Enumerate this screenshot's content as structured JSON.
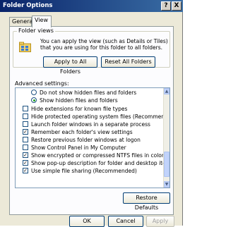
{
  "window": {
    "title": "Folder Options",
    "help_glyph": "?",
    "close_glyph": "X"
  },
  "tabs": [
    {
      "label": "General"
    },
    {
      "label": "View"
    }
  ],
  "folder_views": {
    "legend": "Folder views",
    "description": "You can apply the view (such as Details or Tiles) that you are using for this folder to all folders.",
    "apply_button": "Apply to All Folders",
    "reset_button": "Reset All Folders"
  },
  "advanced": {
    "label": "Advanced settings:",
    "items": [
      {
        "type": "radio",
        "checked": false,
        "label": "Do not show hidden files and folders"
      },
      {
        "type": "radio",
        "checked": true,
        "label": "Show hidden files and folders"
      },
      {
        "type": "check",
        "checked": false,
        "label": "Hide extensions for known file types"
      },
      {
        "type": "check",
        "checked": false,
        "label": "Hide protected operating system files (Recommended)"
      },
      {
        "type": "check",
        "checked": false,
        "label": "Launch folder windows in a separate process"
      },
      {
        "type": "check",
        "checked": true,
        "label": "Remember each folder's view settings"
      },
      {
        "type": "check",
        "checked": false,
        "label": "Restore previous folder windows at logon"
      },
      {
        "type": "check",
        "checked": false,
        "label": "Show Control Panel in My Computer"
      },
      {
        "type": "check",
        "checked": true,
        "label": "Show encrypted or compressed NTFS files in color"
      },
      {
        "type": "check",
        "checked": true,
        "label": "Show pop-up description for folder and desktop items"
      },
      {
        "type": "check",
        "checked": true,
        "label": "Use simple file sharing (Recommended)"
      }
    ],
    "restore_button": "Restore Defaults"
  },
  "footer": {
    "ok": "OK",
    "cancel": "Cancel",
    "apply": "Apply"
  },
  "check_glyph": "✓"
}
